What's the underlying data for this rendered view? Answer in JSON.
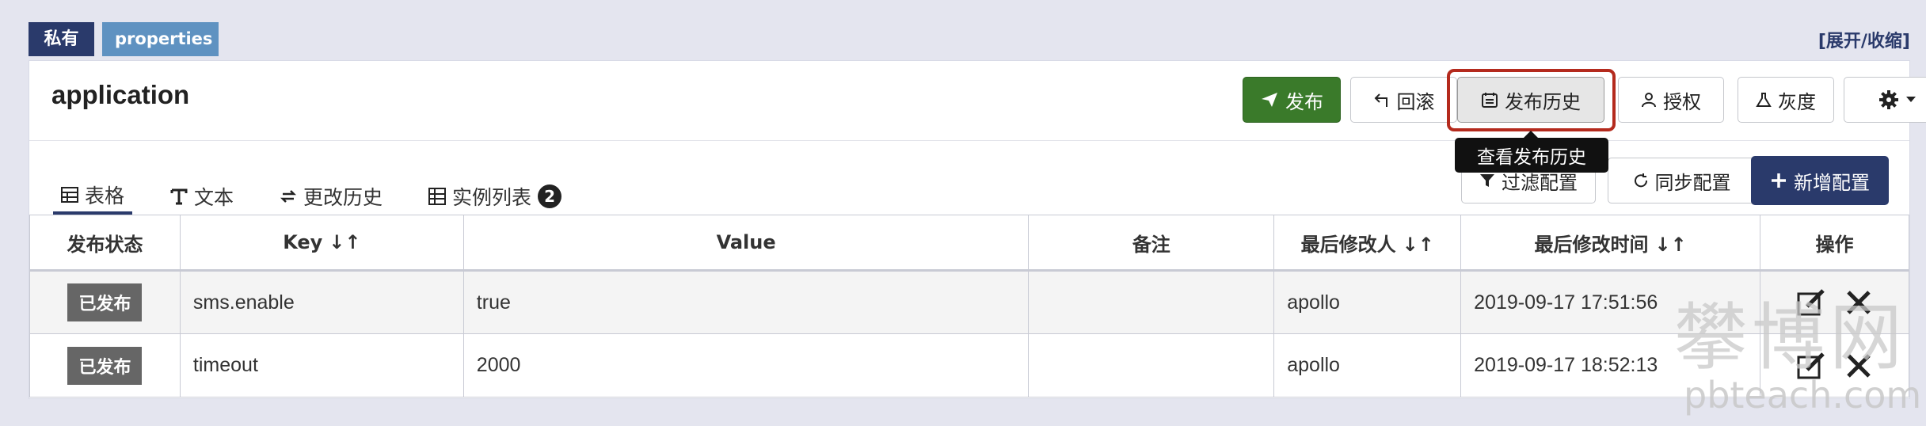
{
  "namespace": {
    "scope_badge": "私有",
    "format_badge": "properties",
    "toggle_link": "[展开/收缩]",
    "app_name": "application"
  },
  "toolbar": {
    "release": "发布",
    "rollback": "回滚",
    "history": "发布历史",
    "history_tooltip": "查看发布历史",
    "authorize": "授权",
    "gray": "灰度"
  },
  "tabs": [
    {
      "label": "表格",
      "icon": "table-icon"
    },
    {
      "label": "文本",
      "icon": "text-icon"
    },
    {
      "label": "更改历史",
      "icon": "change-history-icon"
    },
    {
      "label": "实例列表",
      "icon": "instance-list-icon",
      "count": "2"
    }
  ],
  "actions": {
    "filter": "过滤配置",
    "sync": "同步配置",
    "add": "新增配置"
  },
  "table": {
    "headers": {
      "status": "发布状态",
      "key": "Key",
      "value": "Value",
      "comment": "备注",
      "modifier": "最后修改人",
      "modified_time": "最后修改时间",
      "operation": "操作"
    },
    "rows": [
      {
        "status": "已发布",
        "key": "sms.enable",
        "value": "true",
        "comment": "",
        "modifier": "apollo",
        "time": "2019-09-17 17:51:56"
      },
      {
        "status": "已发布",
        "key": "timeout",
        "value": "2000",
        "comment": "",
        "modifier": "apollo",
        "time": "2019-09-17 18:52:13"
      }
    ]
  },
  "watermark": {
    "chinese": "攀博网",
    "domain": "pbteach.com"
  },
  "colors": {
    "navy": "#2a3a6b",
    "release_green": "#3a7a2a",
    "highlight_red": "#b42a1d",
    "status_gray": "#666666"
  }
}
